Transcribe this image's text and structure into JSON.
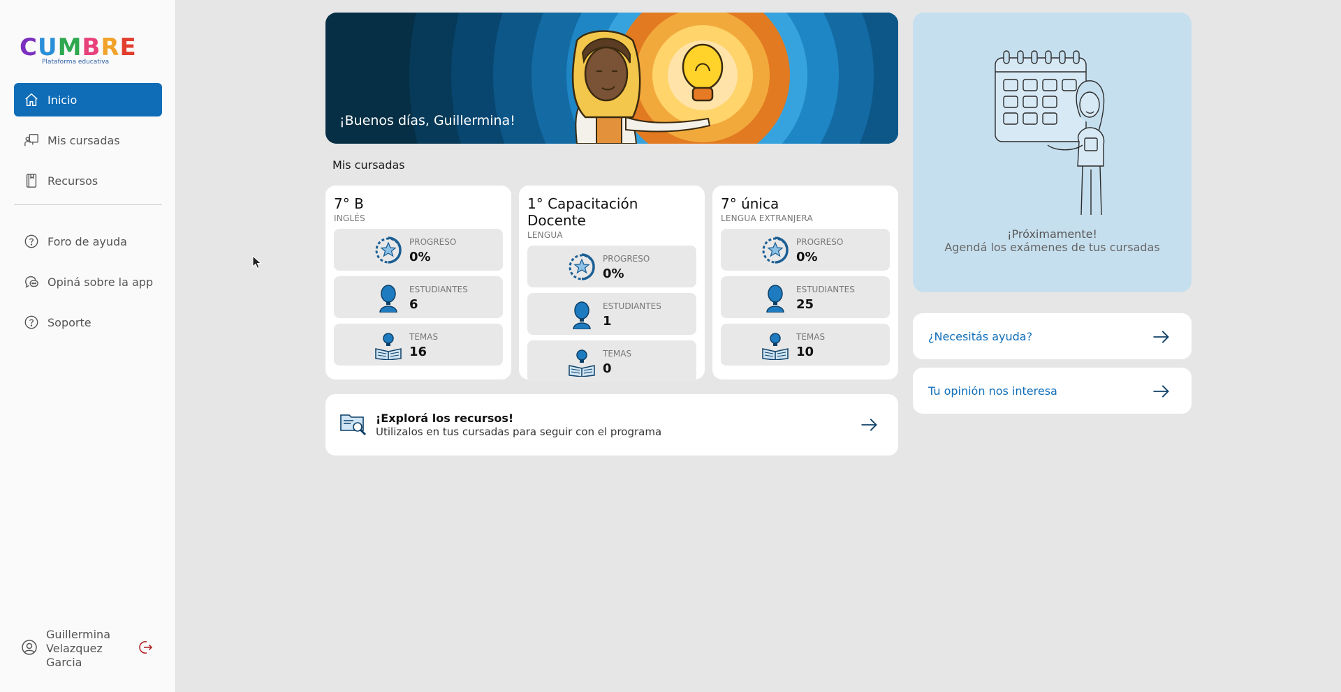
{
  "app": {
    "logo_letters": [
      "C",
      "U",
      "M",
      "B",
      "R",
      "E"
    ],
    "logo_subtitle": "Plataforma educativa"
  },
  "sidebar": {
    "items": [
      {
        "label": "Inicio",
        "icon": "home-icon",
        "active": true
      },
      {
        "label": "Mis cursadas",
        "icon": "teacher-icon",
        "active": false
      },
      {
        "label": "Recursos",
        "icon": "book-icon",
        "active": false
      },
      {
        "label": "Foro de ayuda",
        "icon": "help-circle-icon",
        "active": false
      },
      {
        "label": "Opiná sobre la app",
        "icon": "chat-bubbles-icon",
        "active": false
      },
      {
        "label": "Soporte",
        "icon": "help-circle-icon",
        "active": false
      }
    ],
    "user": {
      "name": "Guillermina Velazquez Garcia",
      "icon": "user-circle-icon",
      "logout_icon": "logout-icon"
    }
  },
  "hero": {
    "greeting": "¡Buenos días, Guillermina!"
  },
  "main": {
    "section_title": "Mis cursadas",
    "courses": [
      {
        "title": "7° B",
        "subject": "INGLÉS",
        "stats": [
          {
            "label": "PROGRESO",
            "value": "0%",
            "icon": "progress-star-icon"
          },
          {
            "label": "ESTUDIANTES",
            "value": "6",
            "icon": "student-icon"
          },
          {
            "label": "TEMAS",
            "value": "16",
            "icon": "open-book-bulb-icon"
          }
        ]
      },
      {
        "title": "1° Capacitación Docente",
        "subject": "LENGUA",
        "stats": [
          {
            "label": "PROGRESO",
            "value": "0%",
            "icon": "progress-star-icon"
          },
          {
            "label": "ESTUDIANTES",
            "value": "1",
            "icon": "student-icon"
          },
          {
            "label": "TEMAS",
            "value": "0",
            "icon": "open-book-bulb-icon"
          }
        ]
      },
      {
        "title": "7° única",
        "subject": "LENGUA EXTRANJERA",
        "stats": [
          {
            "label": "PROGRESO",
            "value": "0%",
            "icon": "progress-star-icon"
          },
          {
            "label": "ESTUDIANTES",
            "value": "25",
            "icon": "student-icon"
          },
          {
            "label": "TEMAS",
            "value": "10",
            "icon": "open-book-bulb-icon"
          }
        ]
      }
    ],
    "explore": {
      "title": "¡Explorá los recursos!",
      "subtitle": "Utilizalos en tus cursadas para seguir con el programa",
      "icon": "folder-search-icon"
    }
  },
  "right": {
    "upcoming_title": "¡Próximamente!",
    "upcoming_subtitle": "Agendá los exámenes de tus cursadas",
    "links": [
      {
        "label": "¿Necesitás ayuda?"
      },
      {
        "label": "Tu opinión nos interesa"
      }
    ]
  },
  "colors": {
    "primary": "#0f6db8",
    "background": "#e6e6e6",
    "card": "#ffffff",
    "upcoming_bg": "#c6dfee"
  }
}
